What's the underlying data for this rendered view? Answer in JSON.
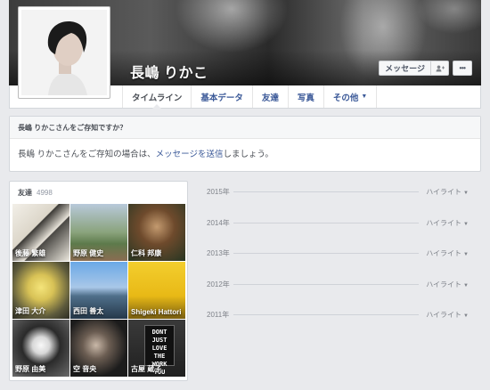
{
  "profile": {
    "name": "長嶋 りかこ"
  },
  "actions": {
    "message_label": "メッセージ",
    "follow_icon": "person-plus-icon",
    "more_label": "•••"
  },
  "nav": {
    "tabs": [
      {
        "label": "タイムライン",
        "active": true
      },
      {
        "label": "基本データ"
      },
      {
        "label": "友達"
      },
      {
        "label": "写真"
      },
      {
        "label": "その他",
        "caret": "▼"
      }
    ]
  },
  "know": {
    "title": "長嶋 りかこさんをご存知ですか？",
    "body_prefix": "長嶋 りかこさんをご存知の場合は、",
    "body_link": "メッセージを送信",
    "body_suffix": "しましょう。"
  },
  "friends": {
    "label": "友達",
    "count": "4998",
    "items": [
      {
        "name": "後藤 繁雄"
      },
      {
        "name": "野原 健史"
      },
      {
        "name": "仁科 邦康"
      },
      {
        "name": "津田 大介"
      },
      {
        "name": "西田 善太"
      },
      {
        "name": "Shigeki Hattori"
      },
      {
        "name": "野原 由美"
      },
      {
        "name": "空 音央"
      },
      {
        "name": "古屋 蔵子"
      }
    ],
    "sign_text": "DONT JUST LOVE THE WORK YOU"
  },
  "timeline": {
    "years": [
      {
        "year": "2015年",
        "highlight": "ハイライト",
        "caret": "▼"
      },
      {
        "year": "2014年",
        "highlight": "ハイライト",
        "caret": "▼"
      },
      {
        "year": "2013年",
        "highlight": "ハイライト",
        "caret": "▼"
      },
      {
        "year": "2012年",
        "highlight": "ハイライト",
        "caret": "▼"
      },
      {
        "year": "2011年",
        "highlight": "ハイライト",
        "caret": "▼"
      }
    ]
  }
}
